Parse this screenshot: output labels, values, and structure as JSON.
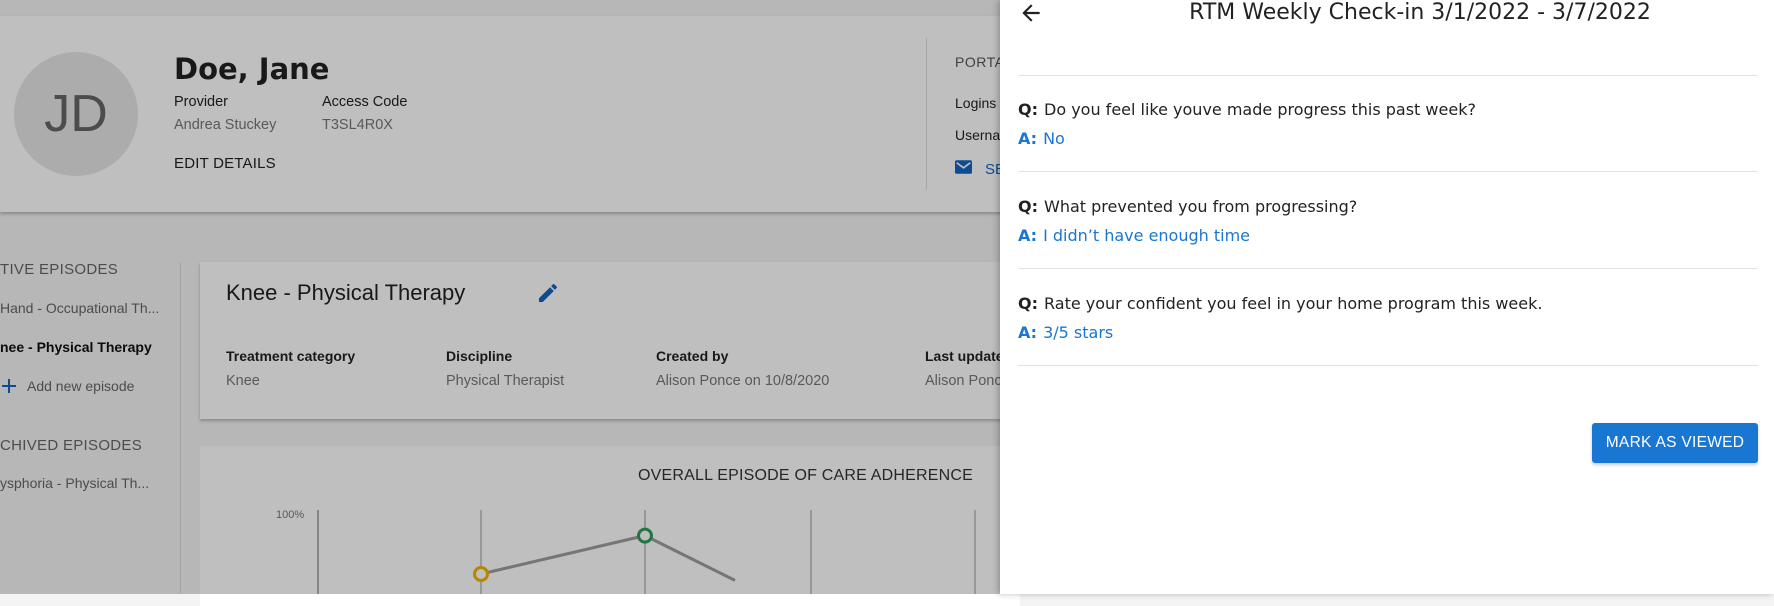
{
  "patient": {
    "initials": "JD",
    "name": "Doe, Jane",
    "provider_label": "Provider",
    "provider_value": "Andrea Stuckey",
    "access_code_label": "Access Code",
    "access_code_value": "T3SL4R0X",
    "edit_details_label": "EDIT DETAILS"
  },
  "portal": {
    "title": "PORTA",
    "logins_label": "Logins",
    "username_label": "Userna",
    "send_label": "SE"
  },
  "sidebar": {
    "active_title": "TIVE EPISODES",
    "active_items": [
      {
        "label": "Hand  - Occupational Th..."
      },
      {
        "label": "nee - Physical Therapy"
      }
    ],
    "add_label": "Add new episode",
    "archived_title": "CHIVED EPISODES",
    "archived_items": [
      {
        "label": "ysphoria - Physical Th..."
      }
    ]
  },
  "episode": {
    "title": "Knee - Physical Therapy",
    "fields": [
      {
        "label": "Treatment category",
        "value": "Knee"
      },
      {
        "label": "Discipline",
        "value": "Physical Therapist"
      },
      {
        "label": "Created by",
        "value": "Alison Ponce on 10/8/2020"
      },
      {
        "label": "Last update",
        "value": "Alison Ponc"
      }
    ]
  },
  "chart_data": {
    "type": "line",
    "title": "OVERALL EPISODE OF CARE ADHERENCE",
    "y_tick_labels": [
      "100%"
    ],
    "ylim": [
      0,
      100
    ],
    "grid": "vertical",
    "series": [
      {
        "values": [
          80,
          92,
          78
        ],
        "color": "#9e9e9e"
      }
    ],
    "point_colors": [
      "#f4b400",
      "#2e9e5b",
      "#9e9e9e"
    ]
  },
  "drawer": {
    "title": "RTM Weekly Check-in 3/1/2022 - 3/7/2022",
    "q_prefix": "Q:",
    "a_prefix": "A:",
    "items": [
      {
        "question": "Do you feel like youve made progress this past week?",
        "answer": "No"
      },
      {
        "question": "What prevented you from progressing?",
        "answer": "I didn’t have enough time"
      },
      {
        "question": "Rate your confident you feel in your home program this week.",
        "answer": "3/5 stars"
      }
    ],
    "mark_button": "MARK AS VIEWED"
  },
  "colors": {
    "primary": "#1976d2",
    "link": "#1565c0"
  }
}
